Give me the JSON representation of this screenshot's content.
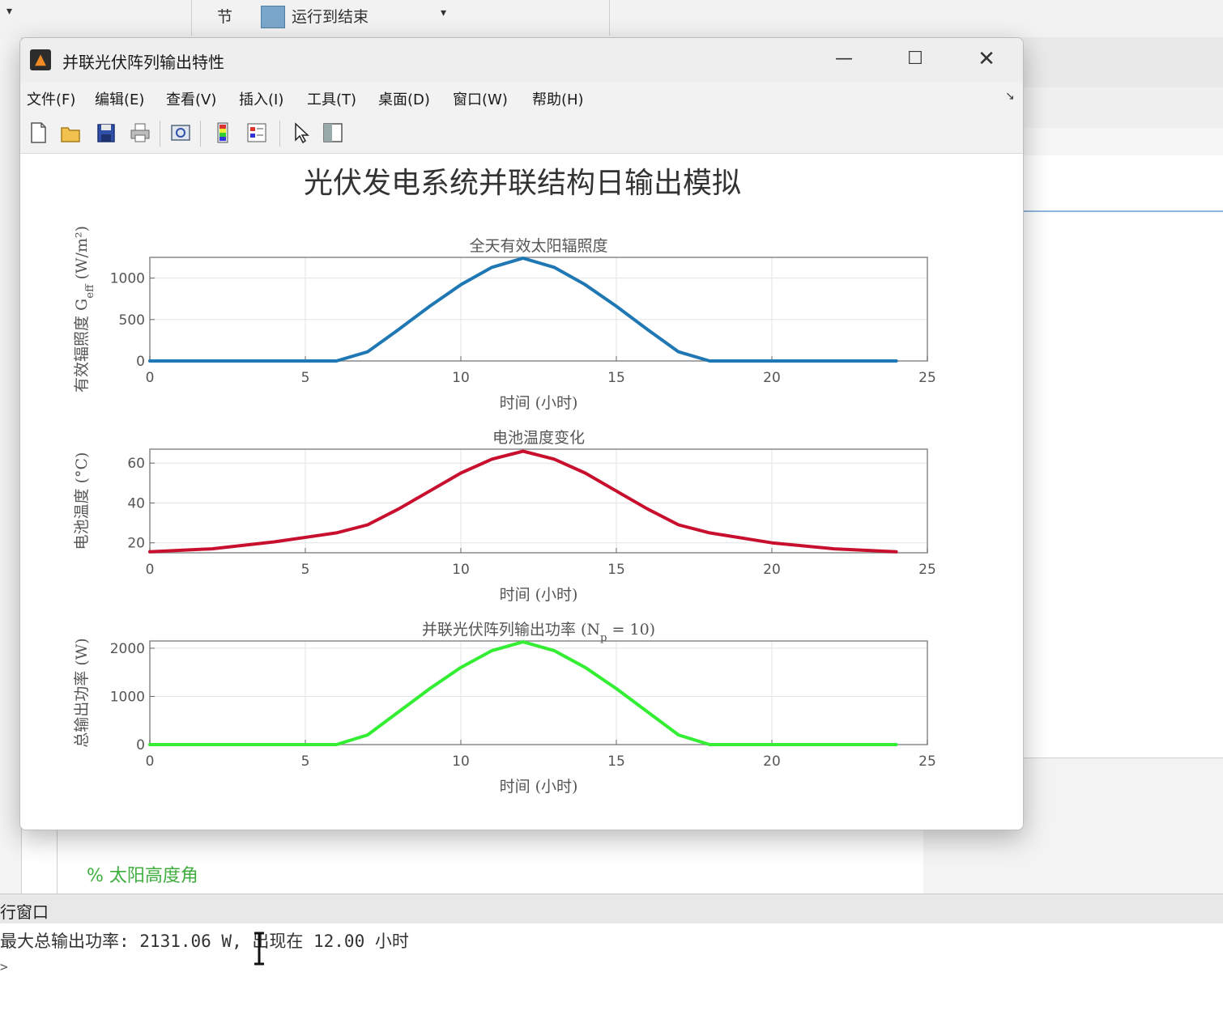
{
  "ribbon": {
    "jie_label": "节",
    "run_label": "运行到结束",
    "dropdown_arrow": "▾",
    "left_arrow": "▾"
  },
  "desktop": {
    "editor_comment": "% 太阳高度角",
    "command_window_title": "行窗口",
    "command_output": "最大总输出功率: 2131.06 W, 出现在 12.00 小时",
    "prompt": ">"
  },
  "figure": {
    "window_title": "并联光伏阵列输出特性",
    "window_buttons": {
      "minimize": "—",
      "maximize": "☐",
      "close": "✕"
    },
    "menu": [
      "文件(F)",
      "编辑(E)",
      "查看(V)",
      "插入(I)",
      "工具(T)",
      "桌面(D)",
      "窗口(W)",
      "帮助(H)"
    ],
    "menu_dock_icon": "↘",
    "toolbar_icons": [
      "new-figure-icon",
      "open-icon",
      "save-icon",
      "print-icon",
      "link-plot-icon",
      "colorbar-icon",
      "legend-icon",
      "pointer-icon",
      "property-inspector-icon"
    ],
    "suptitle": "光伏发电系统并联结构日输出模拟"
  },
  "chart_data": [
    {
      "type": "line",
      "title": "全天有效太阳辐照度",
      "xlabel": "时间 (小时)",
      "ylabel": "有效辐照度 G_eff (W/m²)",
      "xlim": [
        0,
        25
      ],
      "ylim": [
        0,
        1250
      ],
      "xticks": [
        0,
        5,
        10,
        15,
        20,
        25
      ],
      "yticks": [
        0,
        500,
        1000
      ],
      "grid": true,
      "color": "#1f77b4",
      "series": [
        {
          "x": [
            0,
            2,
            4,
            6,
            7,
            8,
            9,
            10,
            11,
            12,
            13,
            14,
            15,
            16,
            17,
            18,
            20,
            22,
            24
          ],
          "values": [
            0,
            0,
            0,
            0,
            110,
            380,
            660,
            920,
            1130,
            1240,
            1130,
            920,
            660,
            380,
            110,
            0,
            0,
            0,
            0
          ]
        }
      ]
    },
    {
      "type": "line",
      "title": "电池温度变化",
      "xlabel": "时间 (小时)",
      "ylabel": "电池温度 (°C)",
      "xlim": [
        0,
        25
      ],
      "ylim": [
        15,
        67
      ],
      "xticks": [
        0,
        5,
        10,
        15,
        20,
        25
      ],
      "yticks": [
        20,
        40,
        60
      ],
      "grid": true,
      "color": "#c8102e",
      "series": [
        {
          "x": [
            0,
            2,
            4,
            6,
            7,
            8,
            9,
            10,
            11,
            12,
            13,
            14,
            15,
            16,
            17,
            18,
            20,
            22,
            24
          ],
          "values": [
            15.5,
            17,
            20.5,
            25,
            29,
            37,
            46,
            55,
            62,
            66,
            62,
            55,
            46,
            37,
            29,
            25,
            20,
            17,
            15.5
          ]
        }
      ]
    },
    {
      "type": "line",
      "title": "并联光伏阵列输出功率 (N_p = 10)",
      "xlabel": "时间 (小时)",
      "ylabel": "总输出功率 (W)",
      "xlim": [
        0,
        25
      ],
      "ylim": [
        0,
        2150
      ],
      "xticks": [
        0,
        5,
        10,
        15,
        20,
        25
      ],
      "yticks": [
        0,
        1000,
        2000
      ],
      "grid": true,
      "color": "#33ee33",
      "series": [
        {
          "x": [
            0,
            2,
            4,
            6,
            7,
            8,
            9,
            10,
            11,
            12,
            13,
            14,
            15,
            16,
            17,
            18,
            20,
            22,
            24
          ],
          "values": [
            0,
            0,
            0,
            0,
            200,
            680,
            1160,
            1600,
            1950,
            2131,
            1950,
            1600,
            1160,
            680,
            200,
            0,
            0,
            0,
            0
          ]
        }
      ]
    }
  ]
}
